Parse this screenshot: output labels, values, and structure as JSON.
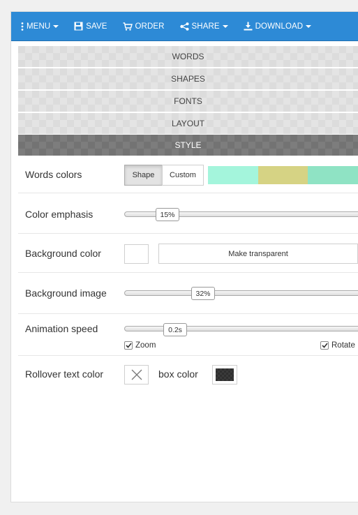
{
  "toolbar": {
    "menu_label": "MENU",
    "save_label": "SAVE",
    "order_label": "ORDER",
    "share_label": "SHARE",
    "download_label": "DOWNLOAD"
  },
  "accordion": {
    "sections": [
      "WORDS",
      "SHAPES",
      "FONTS",
      "LAYOUT",
      "STYLE"
    ],
    "active": "STYLE"
  },
  "style": {
    "words_colors": {
      "label": "Words colors",
      "shape_button": "Shape",
      "custom_button": "Custom",
      "selected": "Shape",
      "palette": [
        "#a4f5dc",
        "#d6d384",
        "#8fe3c4"
      ]
    },
    "color_emphasis": {
      "label": "Color emphasis",
      "value_text": "15%",
      "value": 0.15
    },
    "background_color": {
      "label": "Background color",
      "swatch": "#ffffff",
      "transparent_button": "Make transparent"
    },
    "background_image": {
      "label": "Background image",
      "value_text": "32%",
      "value": 0.32
    },
    "animation_speed": {
      "label": "Animation speed",
      "value_text": "0.2s",
      "zoom_label": "Zoom",
      "zoom_checked": true,
      "rotate_label": "Rotate",
      "rotate_checked": true
    },
    "rollover": {
      "label": "Rollover text color",
      "box_label": "box color",
      "box_swatch": "#3a3a3a"
    }
  },
  "colors": {
    "toolbar": "#2d8ad6",
    "active_section": "#7d7d7d"
  }
}
